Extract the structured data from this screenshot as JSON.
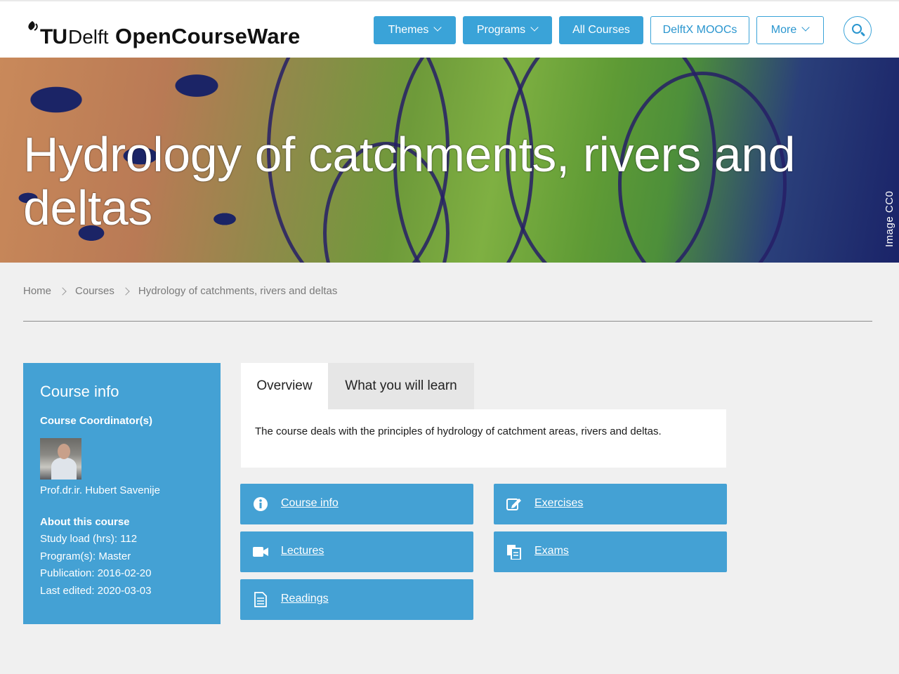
{
  "header": {
    "logo_tu": "TU",
    "logo_delft": "Delft",
    "site_title": "OpenCourseWare",
    "nav": {
      "themes": "Themes",
      "programs": "Programs",
      "all_courses": "All Courses",
      "delftx": "DelftX MOOCs",
      "more": "More"
    },
    "accent_color": "#3aa3d8"
  },
  "hero": {
    "title": "Hydrology of catchments, rivers and deltas",
    "credit": "Image CC0"
  },
  "breadcrumb": {
    "home": "Home",
    "courses": "Courses",
    "current": "Hydrology of catchments, rivers and deltas"
  },
  "sidebar": {
    "title": "Course info",
    "coordinator_heading": "Course Coordinator(s)",
    "coordinator_name": "Prof.dr.ir. Hubert Savenije",
    "about_heading": "About this course",
    "study_load": "Study load (hrs): 112",
    "programs": "Program(s): Master",
    "publication": "Publication: 2016-02-20",
    "last_edited": "Last edited: 2020-03-03"
  },
  "tabs": {
    "overview": "Overview",
    "learn": "What you will learn",
    "overview_text": "The course deals with the principles of hydrology of catchment areas, rivers and deltas."
  },
  "links": {
    "course_info": "Course info",
    "exercises": "Exercises",
    "lectures": "Lectures",
    "exams": "Exams",
    "readings": "Readings"
  }
}
